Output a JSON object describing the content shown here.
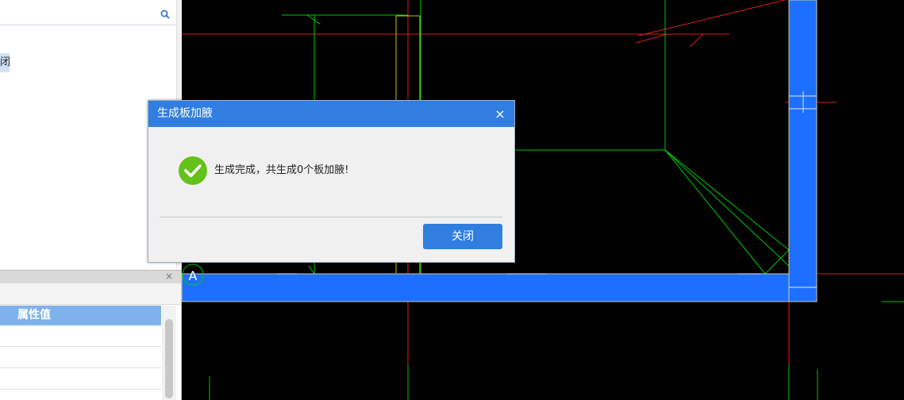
{
  "dialog": {
    "title": "生成板加腋",
    "close_glyph": "×",
    "message": "生成完成，共生成0个板加腋!",
    "close_button_label": "关闭"
  },
  "left_panel": {
    "tree_item_label": "闭",
    "properties": {
      "close_glyph": "×",
      "column_header": "属性值"
    }
  },
  "canvas": {
    "axis_label": "A"
  },
  "colors": {
    "dialog_accent": "#2f7ee0",
    "success": "#63c21a",
    "cad_background": "#000000",
    "cad_green": "#00c800",
    "cad_red": "#d81e1e",
    "cad_yellow": "#c8c800",
    "cad_blue_wall": "#1e6fff"
  }
}
